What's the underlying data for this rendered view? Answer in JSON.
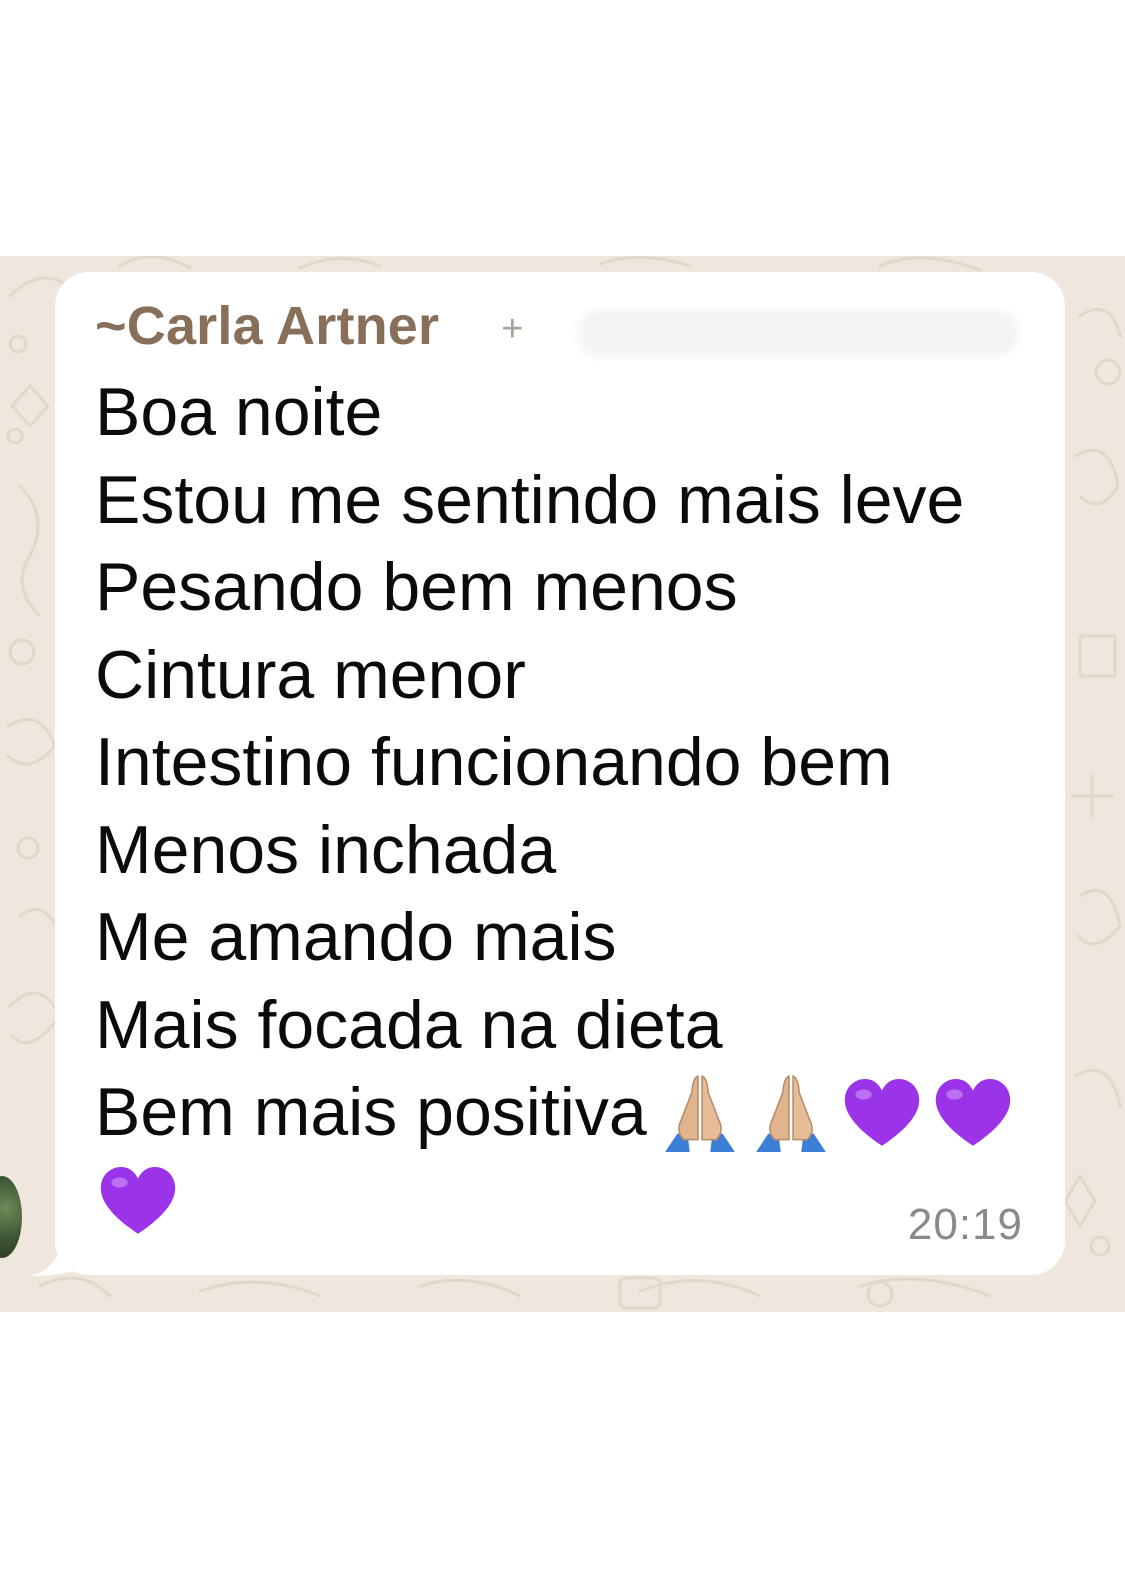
{
  "message": {
    "sender_tilde": "~",
    "sender_name": "Carla Artner",
    "sender_extra": "+",
    "lines": [
      "Boa noite",
      "Estou me sentindo mais leve",
      "Pesando bem menos",
      "Cintura menor",
      "Intestino funcionando bem",
      "Menos inchada",
      "Me amando mais",
      "Mais focada na dieta",
      "Bem mais positiva"
    ],
    "emojis": [
      "folded-hands-icon",
      "folded-hands-icon",
      "purple-heart-icon",
      "purple-heart-icon",
      "purple-heart-icon"
    ],
    "time": "20:19"
  },
  "colors": {
    "sender_name": "#876f5a",
    "chat_background": "#efe7dd",
    "bubble": "#ffffff",
    "heart": "#9b33e8",
    "timestamp": "#8a8a8a"
  }
}
